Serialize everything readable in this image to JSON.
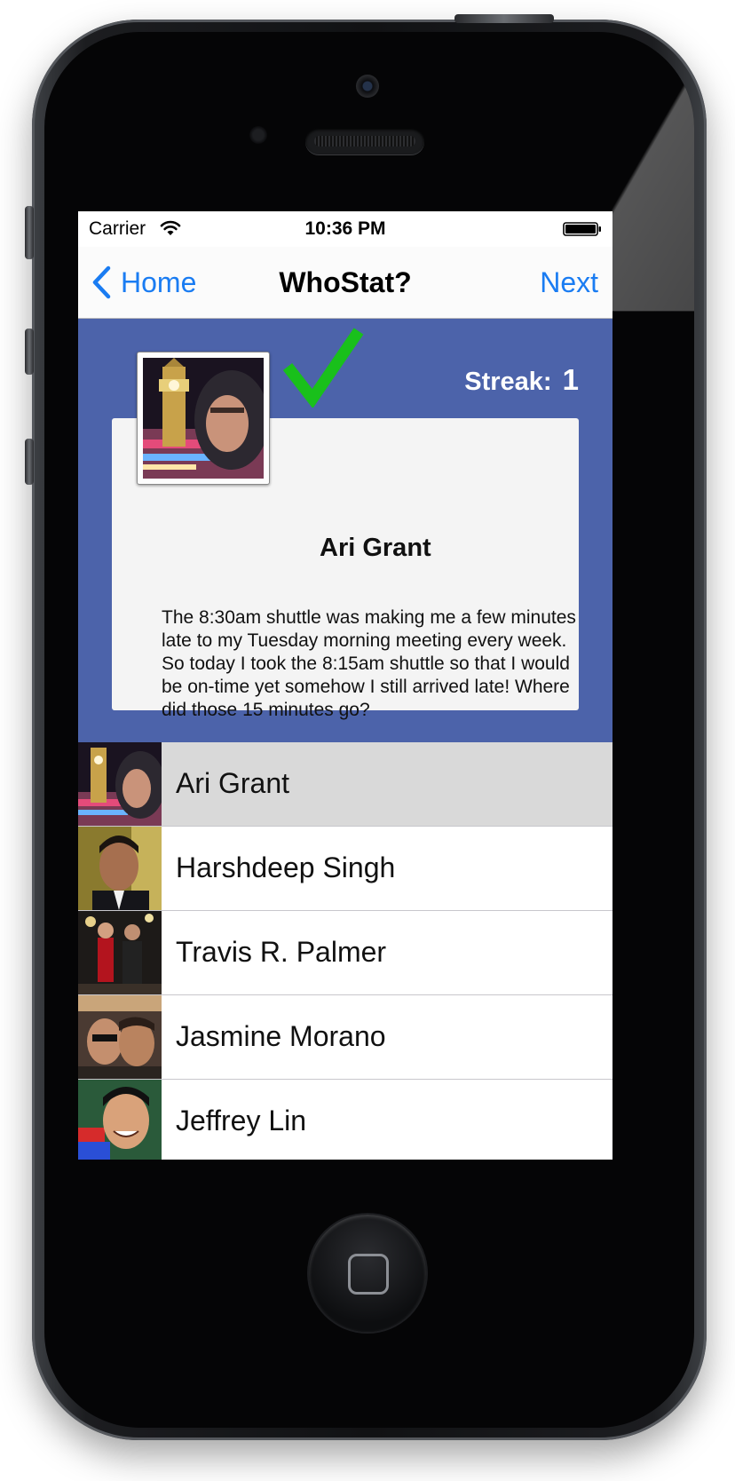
{
  "status_bar": {
    "carrier": "Carrier",
    "time": "10:36 PM"
  },
  "nav": {
    "back_label": "Home",
    "title": "WhoStat?",
    "next_label": "Next"
  },
  "quiz": {
    "streak_label": "Streak:",
    "streak_value": "1",
    "result_icon": "checkmark-icon",
    "author_name": "Ari Grant",
    "status_text": "The 8:30am shuttle was making me a few minutes late to my Tuesday morning meeting every week. So today I took the 8:15am shuttle so that I would be on-time yet somehow I still arrived late! Where did those 15 minutes go?"
  },
  "friends": [
    {
      "name": "Ari Grant",
      "selected": true
    },
    {
      "name": "Harshdeep Singh",
      "selected": false
    },
    {
      "name": "Travis R. Palmer",
      "selected": false
    },
    {
      "name": "Jasmine Morano",
      "selected": false
    },
    {
      "name": "Jeffrey Lin",
      "selected": false
    }
  ],
  "colors": {
    "accent": "#1a7cf2",
    "quiz_background": "#4c63aa",
    "checkmark": "#19c01b",
    "selected_row": "#d9d9d9"
  }
}
